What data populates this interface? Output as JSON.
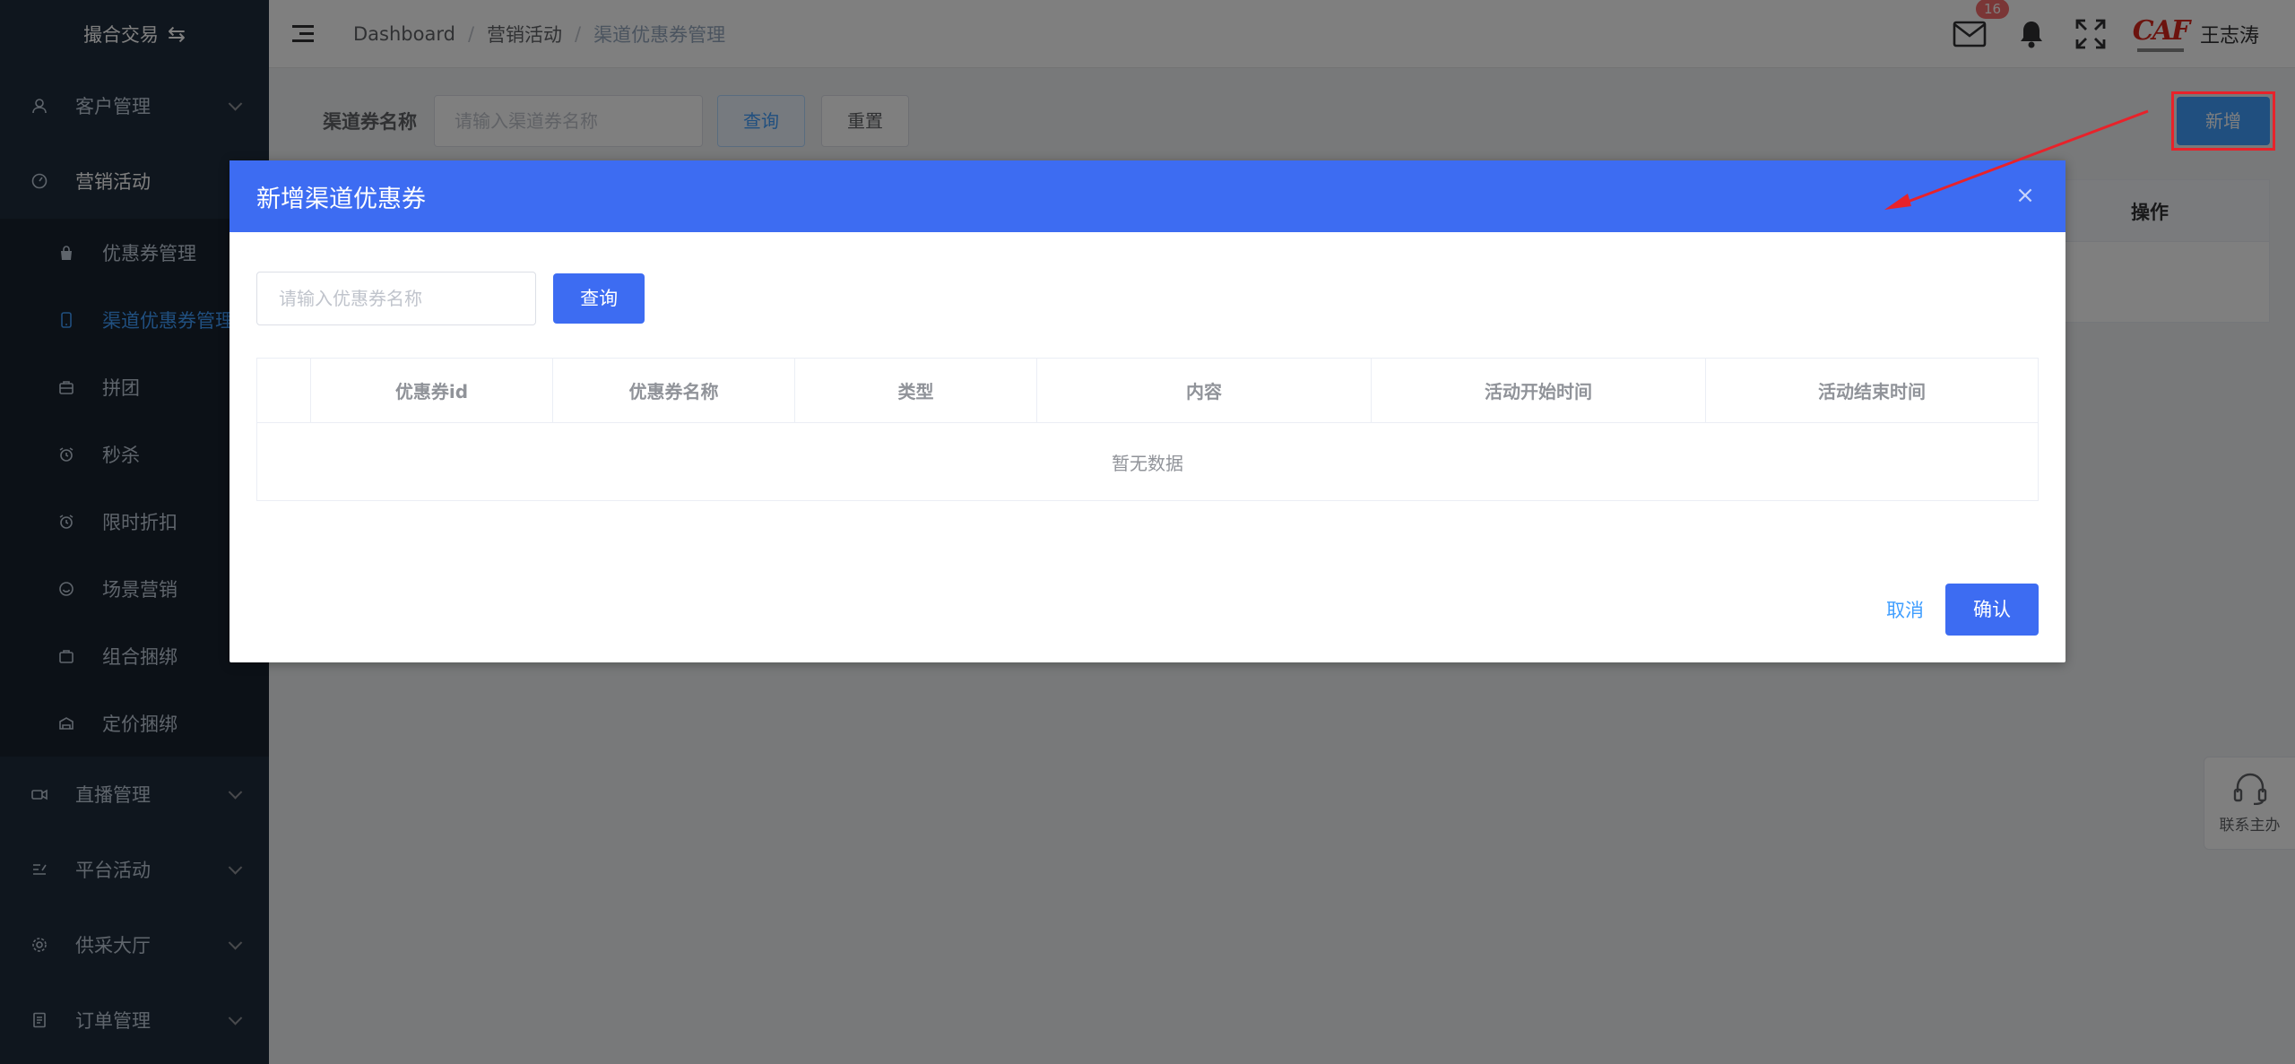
{
  "sidebar": {
    "brand": "撮合交易",
    "groups": [
      {
        "label": "客户管理"
      },
      {
        "label": "营销活动"
      },
      {
        "label": "直播管理"
      },
      {
        "label": "平台活动"
      },
      {
        "label": "供采大厅"
      },
      {
        "label": "订单管理"
      }
    ],
    "sub_items": [
      {
        "label": "优惠券管理"
      },
      {
        "label": "渠道优惠券管理"
      },
      {
        "label": "拼团"
      },
      {
        "label": "秒杀"
      },
      {
        "label": "限时折扣"
      },
      {
        "label": "场景营销"
      },
      {
        "label": "组合捆绑"
      },
      {
        "label": "定价捆绑"
      }
    ]
  },
  "header": {
    "breadcrumb": [
      "Dashboard",
      "营销活动",
      "渠道优惠券管理"
    ],
    "mail_badge": "16",
    "logo_text": "CAF",
    "user_name": "王志涛"
  },
  "content": {
    "filter_label": "渠道券名称",
    "filter_placeholder": "请输入渠道券名称",
    "query_label": "查询",
    "reset_label": "重置",
    "add_label": "新增",
    "table_op_header": "操作",
    "help_label": "联系主办"
  },
  "dialog": {
    "title": "新增渠道优惠券",
    "close": "×",
    "search_placeholder": "请输入优惠券名称",
    "query_label": "查询",
    "columns": [
      "",
      "优惠券id",
      "优惠券名称",
      "类型",
      "内容",
      "活动开始时间",
      "活动结束时间"
    ],
    "empty_text": "暂无数据",
    "cancel_label": "取消",
    "confirm_label": "确认"
  },
  "colors": {
    "sidebar_bg": "#1f2d3d",
    "dialog_header": "#3d6cf2",
    "active_link": "#409eff",
    "annotation_red": "#e8222a"
  }
}
